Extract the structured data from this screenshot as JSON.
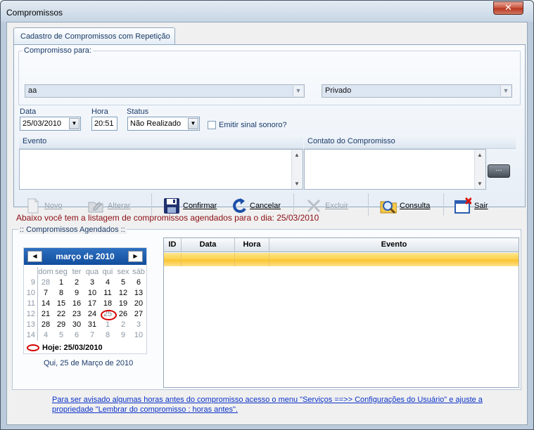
{
  "window": {
    "title": "Compromissos",
    "close_glyph": "✕"
  },
  "tab": {
    "label": "Cadastro de Compromissos com Repetição"
  },
  "compromisso": {
    "group_label": "Compromisso para:",
    "user_value": "aa",
    "privacy_value": "Privado"
  },
  "fields": {
    "data_label": "Data",
    "data_value": "25/03/2010",
    "hora_label": "Hora",
    "hora_value": "20:51",
    "status_label": "Status",
    "status_value": "Não Realizado",
    "sound_label": "Emitir sinal sonoro?"
  },
  "evento": {
    "label": "Evento",
    "value": ""
  },
  "contato": {
    "label": "Contato do Compromisso",
    "value": "",
    "button_label": "..."
  },
  "toolbar": {
    "novo": "Novo",
    "alterar": "Alterar",
    "confirmar": "Confirmar",
    "cancelar": "Cancelar",
    "excluir": "Excluir",
    "consulta": "Consulta",
    "sair": "Sair"
  },
  "info_text": "Abaixo você tem a listagem de compromissos agendados para o dia: 25/03/2010",
  "agendados_label": ":: Compromissos Agendados ::",
  "calendar": {
    "month_title": "março de 2010",
    "prev": "◀",
    "next": "▶",
    "dow": [
      "dom",
      "seg",
      "ter",
      "qua",
      "qui",
      "sex",
      "sáb"
    ],
    "weeks": [
      {
        "wk": "9",
        "days": [
          "28",
          "1",
          "2",
          "3",
          "4",
          "5",
          "6"
        ],
        "other": [
          true,
          false,
          false,
          false,
          false,
          false,
          false
        ]
      },
      {
        "wk": "10",
        "days": [
          "7",
          "8",
          "9",
          "10",
          "11",
          "12",
          "13"
        ],
        "other": [
          false,
          false,
          false,
          false,
          false,
          false,
          false
        ]
      },
      {
        "wk": "11",
        "days": [
          "14",
          "15",
          "16",
          "17",
          "18",
          "19",
          "20"
        ],
        "other": [
          false,
          false,
          false,
          false,
          false,
          false,
          false
        ]
      },
      {
        "wk": "12",
        "days": [
          "21",
          "22",
          "23",
          "24",
          "25",
          "26",
          "27"
        ],
        "other": [
          false,
          false,
          false,
          false,
          false,
          false,
          false
        ]
      },
      {
        "wk": "13",
        "days": [
          "28",
          "29",
          "30",
          "31",
          "1",
          "2",
          "3"
        ],
        "other": [
          false,
          false,
          false,
          false,
          true,
          true,
          true
        ]
      },
      {
        "wk": "14",
        "days": [
          "4",
          "5",
          "6",
          "7",
          "8",
          "9",
          "10"
        ],
        "other": [
          true,
          true,
          true,
          true,
          true,
          true,
          true
        ]
      }
    ],
    "today_day": "25",
    "today_label": "Hoje: 25/03/2010",
    "caption": "Qui, 25 de Março de 2010"
  },
  "grid": {
    "columns": [
      "ID",
      "Data",
      "Hora",
      "Evento"
    ]
  },
  "footer": {
    "line1": "Para ser avisado algumas horas antes do compromisso acesso o menu \"Serviços ==>> Configurações do Usuário\" e ajuste a",
    "line2": "propriedade \"Lembrar do compromisso    :    horas antes\"."
  },
  "colors": {
    "info_red": "#8b0d12",
    "calendar_header": "#1d5db0",
    "selected_row": "#fcd04a",
    "link_blue": "#0a32c8"
  }
}
